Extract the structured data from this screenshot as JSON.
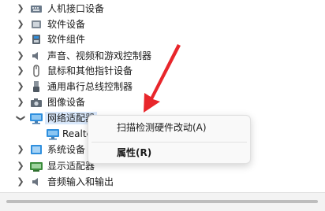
{
  "tree": {
    "items": [
      {
        "label": "人机接口设备",
        "icon": "hid-icon",
        "expanded": false
      },
      {
        "label": "软件设备",
        "icon": "software-device-icon",
        "expanded": false
      },
      {
        "label": "软件组件",
        "icon": "software-component-icon",
        "expanded": false
      },
      {
        "label": "声音、视频和游戏控制器",
        "icon": "speaker-icon",
        "expanded": false
      },
      {
        "label": "鼠标和其他指针设备",
        "icon": "mouse-icon",
        "expanded": false
      },
      {
        "label": "通用串行总线控制器",
        "icon": "usb-icon",
        "expanded": false
      },
      {
        "label": "图像设备",
        "icon": "camera-icon",
        "expanded": false
      },
      {
        "label": "网络适配器",
        "icon": "network-adapter-icon",
        "expanded": true,
        "selected": true
      },
      {
        "label": "Realte",
        "icon": "network-adapter-icon",
        "child": true
      },
      {
        "label": "系统设备",
        "icon": "system-device-icon",
        "expanded": false
      },
      {
        "label": "显示适配器",
        "icon": "display-adapter-icon",
        "expanded": false
      },
      {
        "label": "音频输入和输出",
        "icon": "speaker-icon",
        "expanded": false
      }
    ]
  },
  "context_menu": {
    "scan_label": "扫描检测硬件改动(A)",
    "properties_label": "属性(R)"
  },
  "colors": {
    "accent_blue": "#2f8fde",
    "annotation_red": "#e8262b",
    "selection": "#d9e8fb"
  }
}
